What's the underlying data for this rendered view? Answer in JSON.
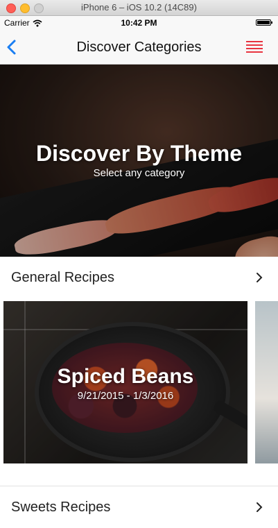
{
  "window": {
    "title": "iPhone 6 – iOS 10.2 (14C89)"
  },
  "status_bar": {
    "carrier": "Carrier",
    "time": "10:42 PM"
  },
  "nav": {
    "title": "Discover Categories",
    "back_icon": "chevron-left-icon",
    "menu_icon": "hamburger-menu-icon"
  },
  "hero": {
    "title": "Discover By Theme",
    "subtitle": "Select any category"
  },
  "sections": [
    {
      "label": "General Recipes",
      "cards": [
        {
          "title": "Spiced Beans",
          "dates": "9/21/2015 - 1/3/2016"
        }
      ]
    },
    {
      "label": "Sweets Recipes"
    }
  ],
  "colors": {
    "accent_blue": "#1a7ef2",
    "menu_red": "#e8333f"
  }
}
